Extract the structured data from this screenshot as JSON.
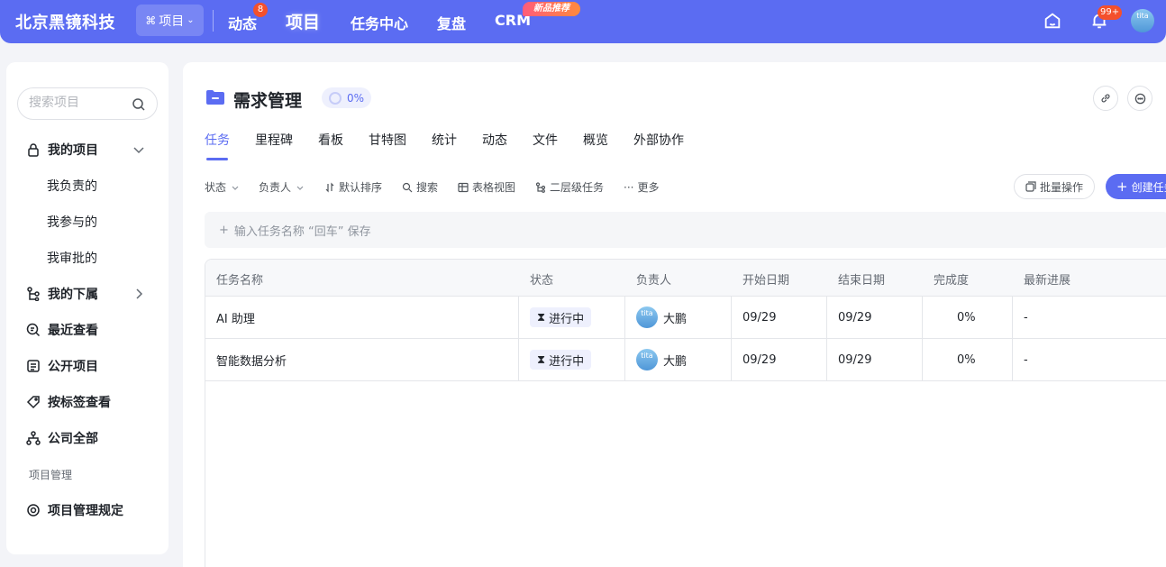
{
  "topbar": {
    "brand": "北京黑镜科技",
    "project_switch": "项目",
    "nav": [
      {
        "label": "动态",
        "badge": "8"
      },
      {
        "label": "项目"
      },
      {
        "label": "任务中心"
      },
      {
        "label": "复盘"
      },
      {
        "label": "CRM",
        "tag": "新品推荐"
      }
    ],
    "notification_badge": "99+",
    "avatar_text": "tita"
  },
  "sidebar": {
    "search_placeholder": "搜索项目",
    "items": [
      {
        "label": "我的项目",
        "icon": "lock-icon"
      },
      {
        "label": "我负责的"
      },
      {
        "label": "我参与的"
      },
      {
        "label": "我审批的"
      },
      {
        "label": "我的下属",
        "icon": "org-tree-icon"
      },
      {
        "label": "最近查看",
        "icon": "recent-search-icon"
      },
      {
        "label": "公开项目",
        "icon": "list-icon"
      },
      {
        "label": "按标签查看",
        "icon": "tag-icon"
      },
      {
        "label": "公司全部",
        "icon": "hierarchy-icon"
      }
    ],
    "section_label": "项目管理",
    "rules_item": "项目管理规定"
  },
  "main": {
    "title": "需求管理",
    "progress": "0%",
    "tabs": [
      "任务",
      "里程碑",
      "看板",
      "甘特图",
      "统计",
      "动态",
      "文件",
      "概览",
      "外部协作"
    ],
    "active_tab": "任务",
    "toolbar": {
      "status": "状态",
      "owner": "负责人",
      "sort": "默认排序",
      "search": "搜索",
      "table_view": "表格视图",
      "secondary_tasks": "二层级任务",
      "more": "更多",
      "batch": "批量操作",
      "create": "创建任务"
    },
    "quick_add_placeholder": "输入任务名称 “回车” 保存",
    "table": {
      "columns": [
        "任务名称",
        "状态",
        "负责人",
        "开始日期",
        "结束日期",
        "完成度",
        "最新进展"
      ],
      "rows": [
        {
          "name": "AI 助理",
          "status": "进行中",
          "owner": "大鹏",
          "start": "09/29",
          "end": "09/29",
          "completion": "0%",
          "latest": "-"
        },
        {
          "name": "智能数据分析",
          "status": "进行中",
          "owner": "大鹏",
          "start": "09/29",
          "end": "09/29",
          "completion": "0%",
          "latest": "-"
        }
      ]
    }
  },
  "colors": {
    "accent": "#5b6cf2",
    "badge": "#f4502c"
  }
}
